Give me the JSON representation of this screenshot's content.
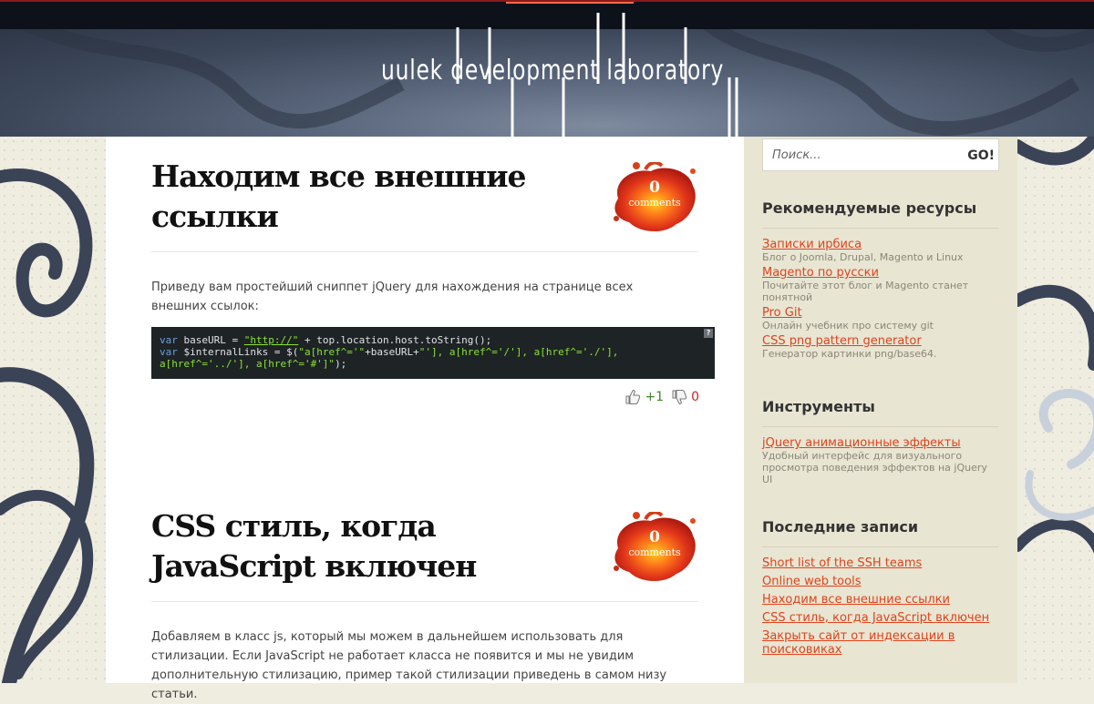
{
  "site": {
    "logo_text": "uulek development laboratory",
    "accent_color": "#e0431b",
    "header_border_color": "#8b1a1a"
  },
  "posts": [
    {
      "title": "Находим все внешние ссылки",
      "comments_count": "0",
      "comments_label": "comments",
      "text": "Приведу вам простейший сниппет jQuery для нахождения на странице всех внешних ссылок:",
      "code_help": "?",
      "votes_up": "+1",
      "votes_down": "0"
    },
    {
      "title": "CSS стиль, когда JavaScript включен",
      "comments_count": "0",
      "comments_label": "comments",
      "text": "Добавляем в класс js, который мы можем в дальнейшем использовать для стилизации. Если JavaScript не работает класса не появится и мы не увидим дополнительную стилизацию, пример такой стилизации приведень в самом низу статьи."
    }
  ],
  "code_snippet": {
    "line1_kw": "var",
    "line1_rest": " baseURL = ",
    "line1_url": "\"http://\"",
    "line1_tail": " + top.location.host.toString();",
    "line2_kw": "var",
    "line2_rest": " $internalLinks = $(",
    "line2_str": "\"a[href^='\"",
    "line2_mid": "+baseURL+",
    "line2_str2": "\"'], a[href^='/'], a[href^='./'],",
    "line3_str": "a[href^='../'], a[href^='#']\"",
    "line3_tail": ");"
  },
  "sidebar": {
    "search": {
      "placeholder": "Поиск...",
      "button_label": "GO!"
    },
    "resources": {
      "title": "Рекомендуемые ресурсы",
      "items": [
        {
          "label": "Записки ирбиса",
          "desc": "Блог о Joomla, Drupal, Magento и Linux"
        },
        {
          "label": "Magento по русски",
          "desc": "Почитайте этот блог и Magento станет понятной"
        },
        {
          "label": "Pro Git",
          "desc": "Онлайн учебник про систему git"
        },
        {
          "label": "CSS png pattern generator",
          "desc": "Генератор картинки png/base64."
        }
      ]
    },
    "tools": {
      "title": "Инструменты",
      "items": [
        {
          "label": "jQuery анимационные эффекты",
          "desc": "Удобный интерфейс для визуального просмотра поведения эффектов на jQuery UI"
        }
      ]
    },
    "recent": {
      "title": "Последние записи",
      "items": [
        "Short list of the SSH teams",
        "Online web tools",
        "Находим все внешние ссылки",
        "CSS стиль, когда JavaScript включен",
        "Закрыть сайт от индексации в поисковиках"
      ]
    }
  }
}
